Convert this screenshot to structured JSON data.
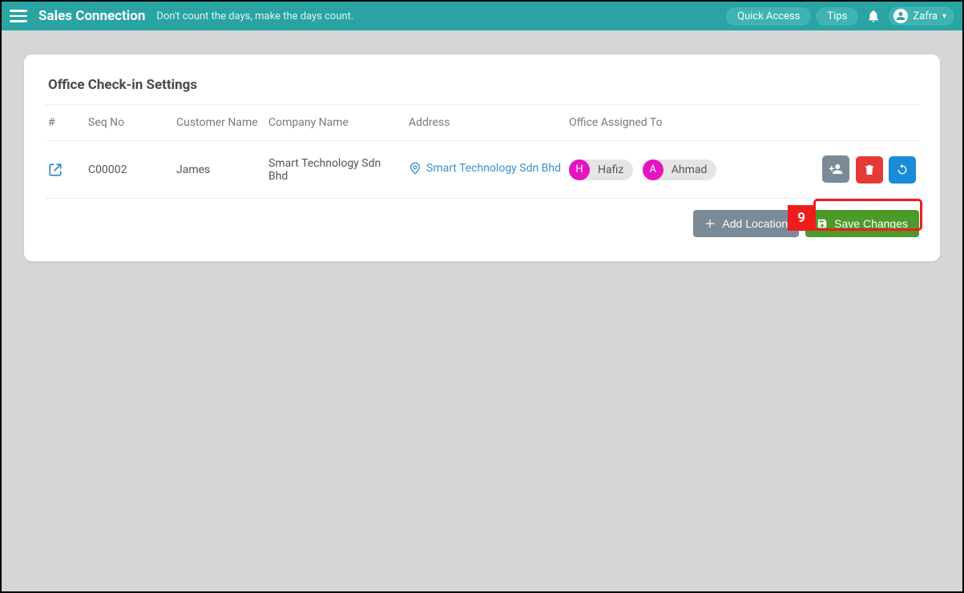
{
  "header": {
    "brand": "Sales Connection",
    "tagline": "Don't count the days, make the days count.",
    "quick_access": "Quick Access",
    "tips": "Tips",
    "user_name": "Zafra"
  },
  "page": {
    "title": "Office Check-in Settings",
    "columns": {
      "hash": "#",
      "seq": "Seq No",
      "customer": "Customer Name",
      "company": "Company Name",
      "address": "Address",
      "assigned": "Office Assigned To"
    },
    "rows": [
      {
        "seq_no": "C00002",
        "customer": "James",
        "company": "Smart Technology Sdn Bhd",
        "address": "Smart Technology Sdn Bhd",
        "assignees": [
          {
            "initial": "H",
            "name": "Hafiz"
          },
          {
            "initial": "A",
            "name": "Ahmad"
          }
        ]
      }
    ],
    "add_location_label": "Add Location",
    "save_label": "Save Changes"
  },
  "annotation": {
    "step": "9"
  }
}
